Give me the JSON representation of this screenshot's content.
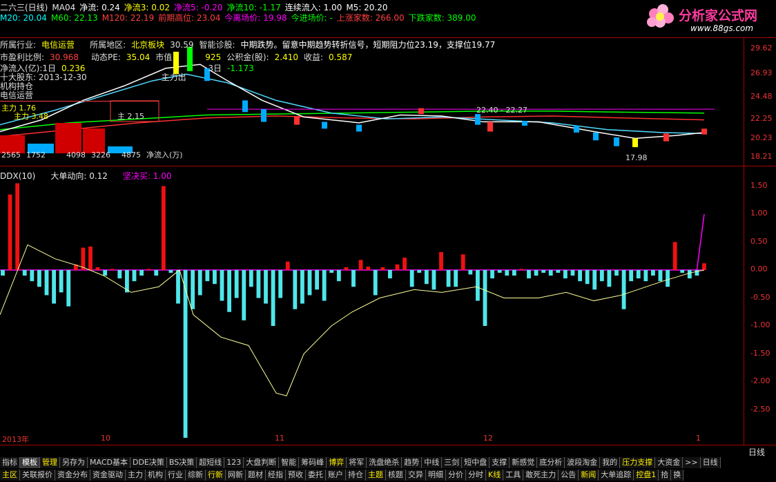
{
  "header": {
    "line1": [
      {
        "text": "二六三(日线)",
        "color": "#e8e8e8"
      },
      {
        "text": "MA04",
        "color": "#e8e8e8"
      },
      {
        "text": "净流: 0.24",
        "color": "#ffffff"
      },
      {
        "text": "净流3: 0.02",
        "color": "#ffff00"
      },
      {
        "text": "净流5: -0.20",
        "color": "#ff00ff"
      },
      {
        "text": "净流10: -1.17",
        "color": "#00ff00"
      },
      {
        "text": "连续流入: 1.00",
        "color": "#ffffff"
      },
      {
        "text": "M5: 20.20",
        "color": "#ffffff"
      }
    ],
    "line2": [
      {
        "text": "M20: 20.04",
        "color": "#00ffff"
      },
      {
        "text": "M60: 22.13",
        "color": "#00ff00"
      },
      {
        "text": "M120: 22.19",
        "color": "#ff4040"
      },
      {
        "text": "前期高位: 23.04",
        "color": "#ff4040"
      },
      {
        "text": "今离场价: 19.98",
        "color": "#ff00ff"
      },
      {
        "text": "今进场价: -",
        "color": "#00ff00"
      },
      {
        "text": "上涨家数: 266.00",
        "color": "#ff4040"
      },
      {
        "text": "下跌家数: 389.00",
        "color": "#00ff00"
      }
    ]
  },
  "logo": {
    "text": "分析家公式网",
    "url_text": "www.88gs.com"
  },
  "info": {
    "row1": [
      "所属行业:",
      "电信运营",
      "所属地区:",
      "北京板块",
      "30.59",
      "智能诊股:",
      "中期跌势。留意中期趋势转折信号，短期阻力位23.19，支撑位19.77"
    ],
    "row2": [
      "市盈利比例:",
      "30.968",
      "动态PE:",
      "35.04",
      "市值",
      "925",
      "公积金(股):",
      "2.410",
      "收益:",
      "0.587"
    ],
    "row3": [
      "净流入(亿):1日",
      "0.236",
      "3日",
      "-1.173"
    ],
    "row4": [
      "十大股东: 2013-12-30",
      "主力出"
    ],
    "row5": [
      "机构持仓"
    ],
    "row6": [
      "电信运营"
    ],
    "boxes": [
      "主力 1.76",
      "主力 3.48",
      "主 2.15"
    ],
    "bottom": [
      "2565",
      "1752",
      "4098",
      "3226",
      "4875",
      "净流入(万)"
    ],
    "price_labels": [
      "22.40 - 22.27",
      "17.98"
    ]
  },
  "price_axis": [
    "29.62",
    "26.93",
    "24.48",
    "22.25",
    "20.23",
    "18.21"
  ],
  "indicator_header": [
    {
      "text": "DDX(10)",
      "color": "#e8e8e8"
    },
    {
      "text": "大单动向: 0.12",
      "color": "#e8e8e8"
    },
    {
      "text": "坚决买: 1.00",
      "color": "#ff00ff"
    }
  ],
  "ind_axis": [
    "1.50",
    "1.00",
    "0.50",
    "0.00",
    "-0.50",
    "-1.00",
    "-1.50",
    "-2.00",
    "-2.50"
  ],
  "time_axis": [
    "2013年",
    "10",
    "11",
    "12",
    "1"
  ],
  "corner_label": "日线",
  "chart_data": {
    "type": "bar",
    "title": "DDX(10)",
    "xlabel": "",
    "ylabel": "",
    "ylim": [
      -3.0,
      1.6
    ],
    "grid": false,
    "series": [
      {
        "name": "大单动向",
        "values": [
          -0.1,
          1.35,
          1.55,
          -0.1,
          -0.2,
          -0.3,
          -0.45,
          -0.6,
          -0.4,
          -0.65,
          0.1,
          0.4,
          0.42,
          0.05,
          -0.1,
          0.02,
          -0.15,
          -0.4,
          -0.2,
          -0.1,
          0.02,
          -0.1,
          1.5,
          -0.05,
          -0.6,
          -3.0,
          -0.7,
          -0.45,
          -0.2,
          -0.25,
          -0.55,
          -0.75,
          -0.5,
          -0.9,
          -0.3,
          -0.5,
          -0.6,
          -1.0,
          -0.5,
          0.15,
          -0.7,
          -0.6,
          -0.45,
          -0.35,
          -0.55,
          -0.05,
          -0.2,
          0.05,
          -0.3,
          0.18,
          0.06,
          -0.45,
          0.05,
          -0.15,
          0.1,
          0.22,
          -0.3,
          -0.05,
          -0.25,
          -0.35,
          0.32,
          -0.3,
          -0.3,
          0.28,
          -0.08,
          -0.55,
          -1.0,
          -0.15,
          -0.05,
          -0.1,
          -0.1,
          0.02,
          -0.15,
          -0.1,
          -0.05,
          -0.1,
          -0.05,
          -0.15,
          -0.1,
          -0.2,
          -0.25,
          -0.35,
          -0.2,
          -0.3,
          -0.1,
          -0.7,
          -0.2,
          -0.15,
          -0.2,
          -0.1,
          -0.2,
          -0.3,
          0.5,
          -0.05,
          -0.15,
          -0.1,
          0.12
        ]
      },
      {
        "name": "坚决买",
        "values": [
          0,
          0,
          0,
          0,
          0,
          0,
          0,
          0,
          0,
          0,
          0,
          0,
          0,
          0,
          0,
          0,
          0,
          0,
          0,
          0,
          0,
          0,
          0,
          0,
          0,
          0,
          0,
          0,
          0,
          0,
          0,
          0,
          0,
          0,
          0,
          0,
          0,
          0,
          0,
          0,
          0,
          0,
          0,
          0,
          0,
          0,
          0,
          0,
          0,
          0,
          0,
          0,
          0,
          0,
          0,
          0,
          0,
          0,
          0,
          0,
          0,
          0,
          0,
          0,
          0,
          0,
          0,
          0,
          0,
          0,
          0,
          0,
          0,
          0,
          0,
          0,
          0,
          0,
          0,
          0,
          0,
          0,
          0,
          0,
          0,
          0,
          0,
          0,
          0,
          0,
          0,
          0,
          0,
          0,
          0,
          0,
          1.0
        ]
      }
    ]
  },
  "tabs_row1": [
    "指标",
    "模板",
    "管理",
    "另存为",
    "MACD基本",
    "DDE决策",
    "BS决策",
    "超短线",
    "123",
    "大盘判断",
    "智能",
    "筹码峰",
    "博弈",
    "将军",
    "洗盘绝杀",
    "趋势",
    "中线",
    "三剑",
    "短中盘",
    "支撑",
    "新感觉",
    "底分析",
    "波段淘金",
    "我的",
    "压力支撑",
    "大资金",
    ">>",
    "日线"
  ],
  "tabs_row2": [
    "主区",
    "关联报价",
    "资金分布",
    "资金驱动",
    "主力",
    "机构",
    "行业",
    "综新",
    "行新",
    "网新",
    "题材",
    "经指",
    "预收",
    "委托",
    "账户",
    "持仓",
    "主题",
    "核题",
    "交异",
    "明细",
    "分价",
    "分时",
    "K线",
    "工具",
    "敢死主力",
    "公告",
    "新闻",
    "大单追踪",
    "控盘1",
    "拾",
    "换"
  ]
}
